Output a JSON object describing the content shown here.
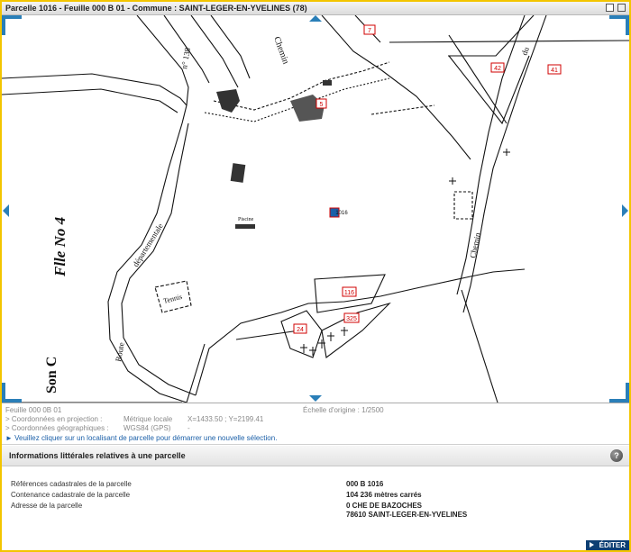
{
  "window": {
    "title": "Parcelle 1016 - Feuille 000 B 01 - Commune : SAINT-LEGER-EN-YVELINES (78)"
  },
  "map": {
    "parcel_labels": [
      "7",
      "42",
      "41",
      "5",
      "1016",
      "116",
      "24",
      "325"
    ],
    "text_labels": {
      "chemin_top": "Chemin",
      "n138": "n° 138",
      "rd": "du",
      "feuille": "Flle No 4",
      "section": "Son C",
      "route": "Route",
      "departementale": "départementale",
      "tennis": "Tennis",
      "piscine": "Piscine",
      "chemin_right": "Chemin"
    }
  },
  "info": {
    "feuille": "Feuille 000 0B 01",
    "echelle": "Échelle d'origine : 1/2500",
    "coord_proj_label": "> Coordonnées en projection :",
    "coord_proj_system": "Métrique locale",
    "coord_proj_value": "X=1433.50 ; Y=2199.41",
    "coord_geo_label": "> Coordonnées géographiques :",
    "coord_geo_system": "WGS84 (GPS)",
    "coord_geo_value": "-",
    "hint": "► Veuillez cliquer sur un localisant de parcelle pour démarrer une nouvelle sélection."
  },
  "panel": {
    "title": "Informations littérales relatives à une parcelle",
    "help": "?",
    "rows": [
      {
        "label": "Références cadastrales de la parcelle",
        "value": "000 B 1016"
      },
      {
        "label": "Contenance cadastrale de la parcelle",
        "value": "104 236 mètres carrés"
      },
      {
        "label": "Adresse de la parcelle",
        "value": "0 CHE DE BAZOCHES"
      }
    ],
    "address_line2": "78610 SAINT-LEGER-EN-YVELINES",
    "edit_label": "ÉDITER"
  },
  "colors": {
    "accent_frame": "#f3c500",
    "nav_arrow": "#2a7fb8",
    "parcel_marker": "#d00000",
    "edit_button": "#0d3f73"
  }
}
